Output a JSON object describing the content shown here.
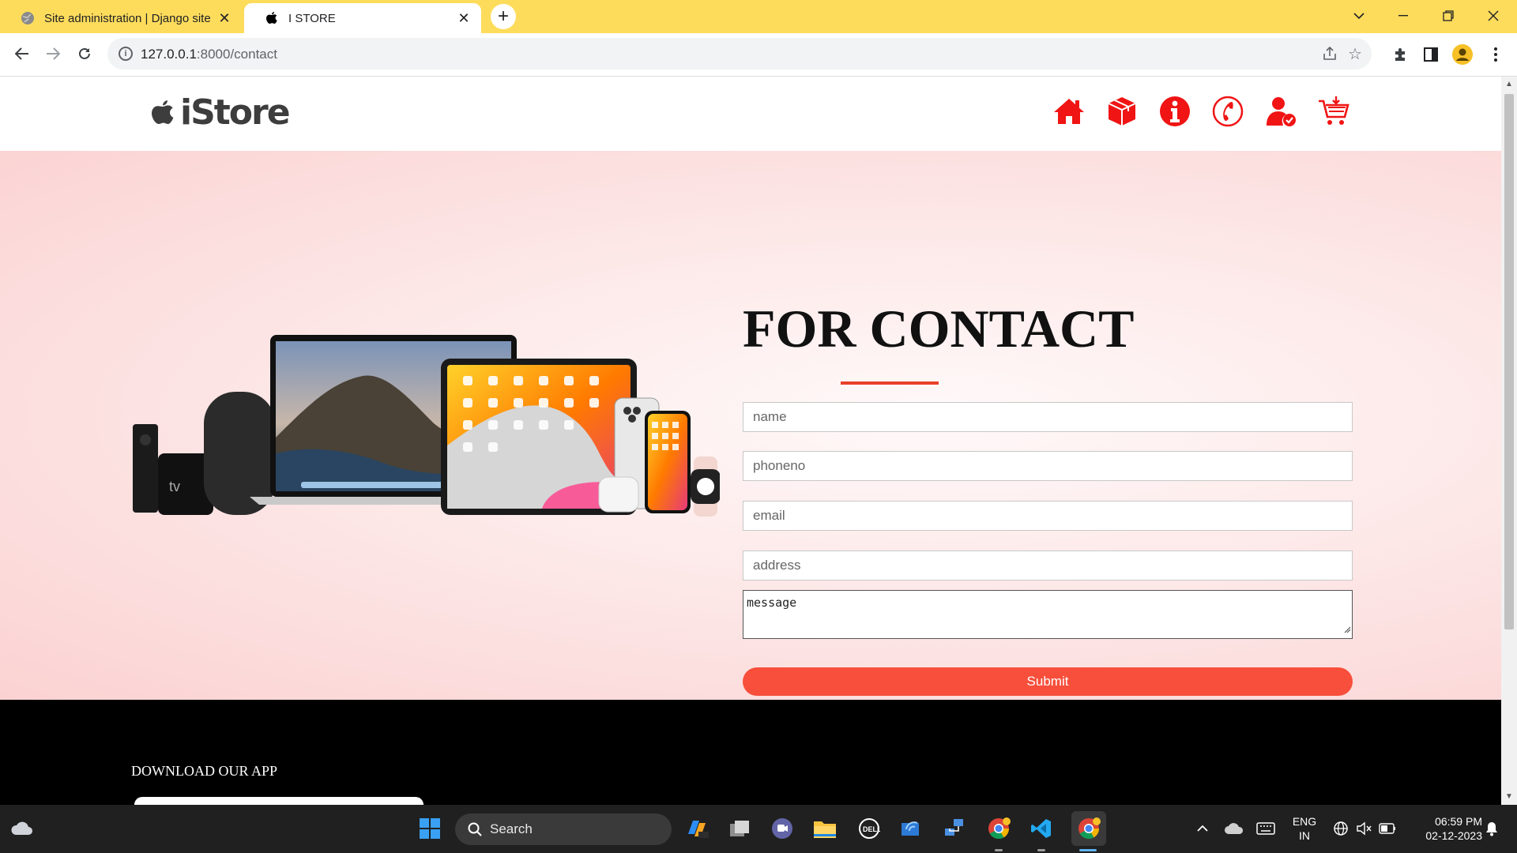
{
  "browser": {
    "tabs": [
      {
        "title": "Site administration | Django site",
        "active": false
      },
      {
        "title": "I STORE",
        "active": true
      }
    ],
    "url": {
      "host": "127.0.0.1",
      "path": ":8000/contact"
    }
  },
  "site": {
    "brand": "iStore",
    "nav_icons": [
      "home-icon",
      "package-icon",
      "info-icon",
      "phone-icon",
      "account-icon",
      "cart-icon"
    ],
    "accent_color": "#f74f3b"
  },
  "contact": {
    "title": "FOR CONTACT",
    "name_placeholder": "name",
    "phone_placeholder": "phoneno",
    "email_placeholder": "email",
    "address_placeholder": "address",
    "message_placeholder": "message",
    "submit_label": "Submit"
  },
  "footer": {
    "download_label": "DOWNLOAD OUR APP"
  },
  "taskbar": {
    "search_label": "Search",
    "lang_line1": "ENG",
    "lang_line2": "IN",
    "time": "06:59 PM",
    "date": "02-12-2023"
  }
}
